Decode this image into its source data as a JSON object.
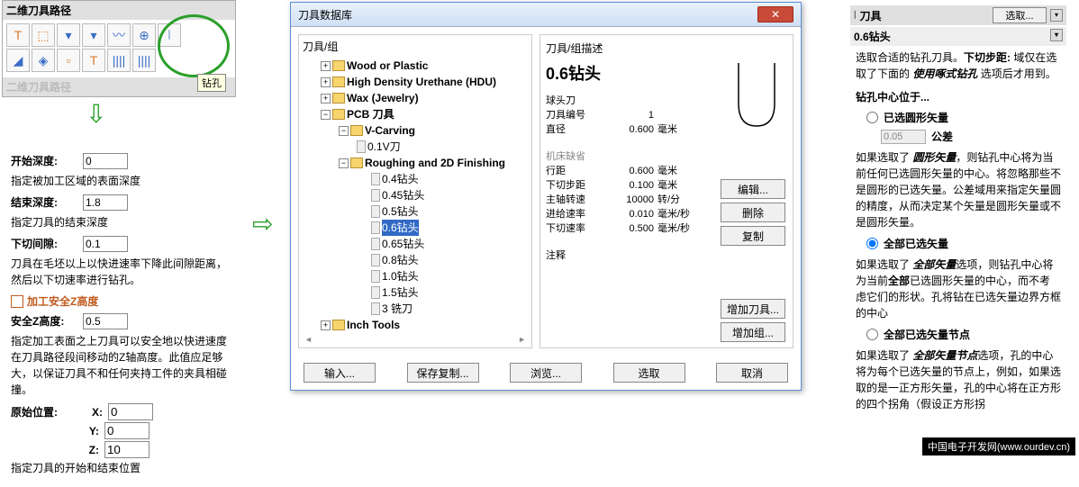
{
  "left": {
    "title": "二维刀具路径",
    "truncated": "二维刀具路径",
    "drill_tip": "钻孔",
    "start_depth_lbl": "开始深度:",
    "start_depth": "0",
    "start_depth_desc": "指定被加工区域的表面深度",
    "end_depth_lbl": "结束深度:",
    "end_depth": "1.8",
    "end_depth_desc": "指定刀具的结束深度",
    "peck_lbl": "下切间隙:",
    "peck": "0.1",
    "peck_desc": "刀具在毛坯以上以快进速率下降此间隙距离，然后以下切速率进行钻孔。",
    "safez_title": "加工安全Z高度",
    "safez_lbl": "安全Z高度:",
    "safez": "0.5",
    "safez_desc": "指定加工表面之上刀具可以安全地以快进速度在刀具路径段间移动的Z轴高度。此值应足够大，以保证刀具不和任何夹持工件的夹具相碰撞。",
    "home_lbl": "原始位置:",
    "x_lbl": "X:",
    "x": "0",
    "y_lbl": "Y:",
    "y": "0",
    "z_lbl": "Z:",
    "z": "10",
    "home_desc": "指定刀具的开始和结束位置"
  },
  "dlg": {
    "title": "刀具数据库",
    "tree_lbl": "刀具/组",
    "desc_lbl": "刀具/组描述",
    "tree": {
      "n0": "Wood or Plastic",
      "n1": "High Density Urethane (HDU)",
      "n2": "Wax (Jewelry)",
      "n3": "PCB 刀具",
      "n4": "V-Carving",
      "n5": "0.1V刀",
      "n6": "Roughing and 2D Finishing",
      "n7": "0.4钻头",
      "n8": "0.45钻头",
      "n9": "0.5钻头",
      "n10": "0.6钻头",
      "n11": "0.65钻头",
      "n12": "0.8钻头",
      "n13": "1.0钻头",
      "n14": "1.5钻头",
      "n15": "3 铣刀",
      "n16": "Inch Tools"
    },
    "tool_name": "0.6钻头",
    "props": {
      "type_k": "球头刀",
      "num_k": "刀具编号",
      "num_v": "1",
      "dia_k": "直径",
      "dia_v": "0.600",
      "dia_u": "毫米",
      "step_k": "行距",
      "step_v": "0.600",
      "step_u": "毫米",
      "down_k": "下切步距",
      "down_v": "0.100",
      "down_u": "毫米",
      "spin_k": "主轴转速",
      "spin_v": "10000",
      "spin_u": "转/分",
      "feed_k": "进给速率",
      "feed_v": "0.010",
      "feed_u": "毫米/秒",
      "plunge_k": "下切速率",
      "plunge_v": "0.500",
      "plunge_u": "毫米/秒",
      "note_k": "注释"
    },
    "btns": {
      "edit": "编辑...",
      "del": "删除",
      "copy": "复制",
      "add_tool": "增加刀具...",
      "add_group": "增加组...",
      "import": "输入...",
      "save": "保存复制...",
      "browse": "浏览...",
      "select": "选取",
      "cancel": "取消"
    }
  },
  "right": {
    "title": "刀具",
    "select_btn": "选取...",
    "sub": "0.6钻头",
    "intro1": "选取合适的钻孔刀具。",
    "intro_b1": "下切步距:",
    "intro2": " 域仅在选取了下面的 ",
    "intro_b2": "使用啄式钻孔",
    "intro3": " 选项后才用到。",
    "center_hdr": "钻孔中心位于...",
    "r1": "已选圆形矢量",
    "tol_v": "0.05",
    "tol_lbl": "公差",
    "r1_desc1": "如果选取了 ",
    "r1_b": "圆形矢量",
    "r1_desc2": "，则钻孔中心将为当前任何已选圆形矢量的中心。将忽略那些不是圆形的已选矢量。公差域用来指定矢量圆的精度，从而决定某个矢量是圆形矢量或不是圆形矢量。",
    "r2": "全部已选矢量",
    "r2_desc1": "如果选取了 ",
    "r2_b": "全部矢量",
    "r2_desc2": "选项，则钻孔中心将为当前",
    "r2_b2": "全部",
    "r2_desc3": "已选圆形矢量的中心，而不考虑它们的形状。孔将钻在已选矢量边界方框的中心",
    "r3": "全部已选矢量节点",
    "r3_desc1": "如果选取了 ",
    "r3_b": "全部矢量节点",
    "r3_desc2": "选项，孔的中心将为每个已选矢量的节点上，例如，如果选取的是一正方形矢量，孔的中心将在正方形的四个拐角（假设正方形拐"
  },
  "watermark": "中国电子开发网(www.ourdev.cn)"
}
